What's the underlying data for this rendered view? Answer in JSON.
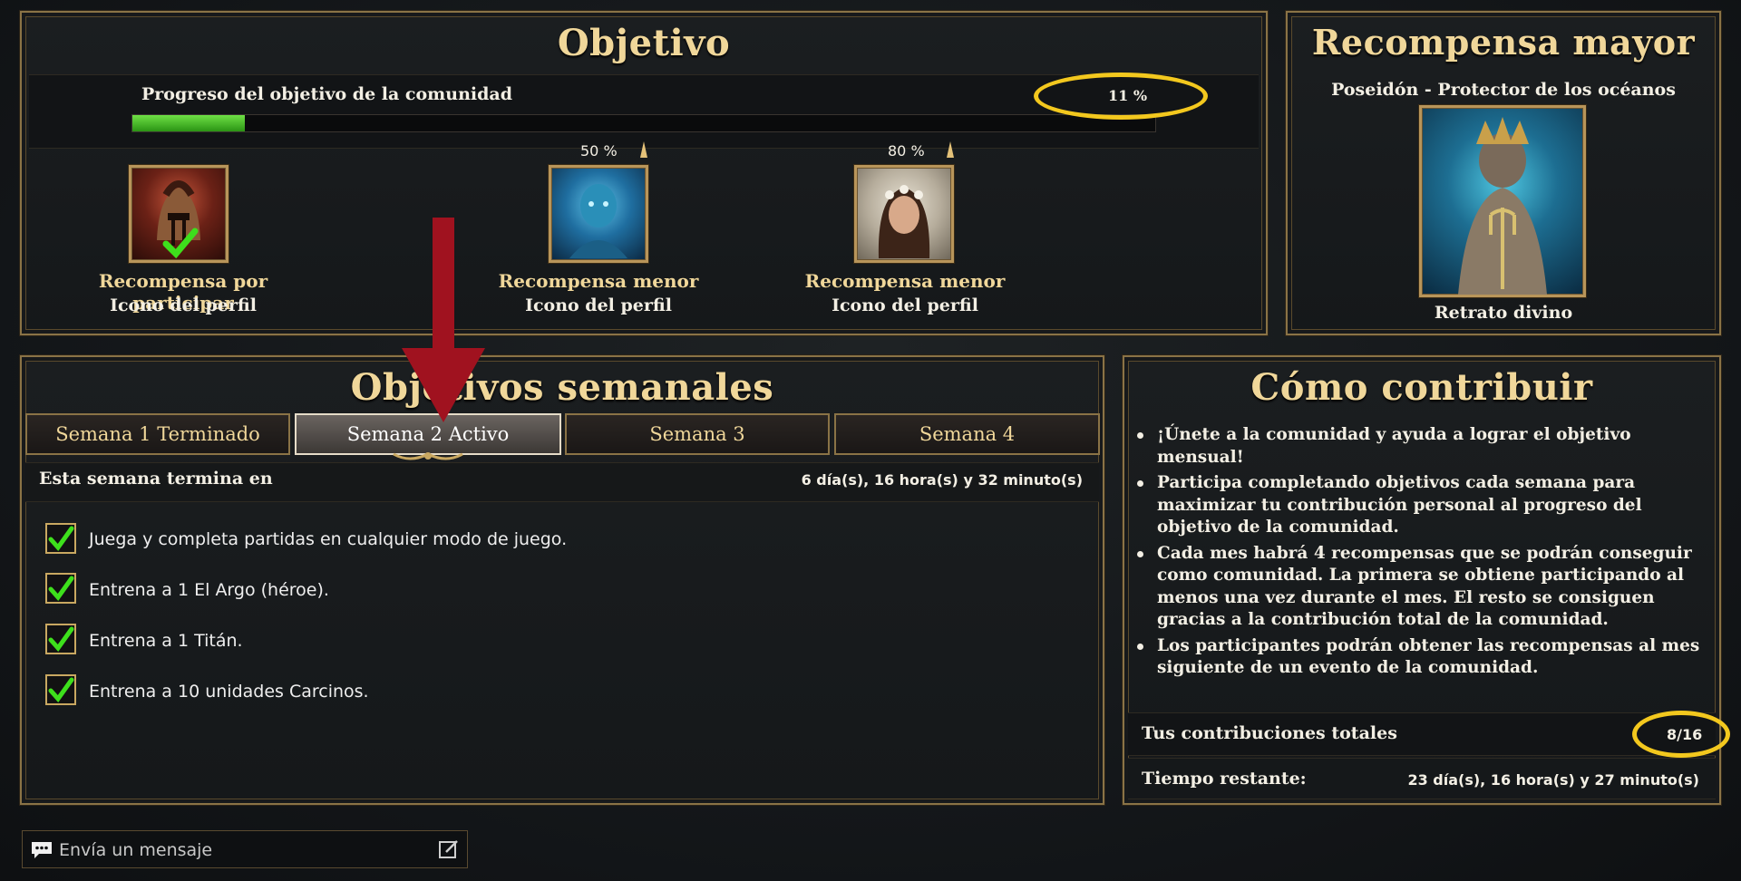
{
  "objective": {
    "title": "Objetivo",
    "progress_label": "Progreso del objetivo de la comunidad",
    "progress_value": "11 %",
    "progress_fraction": 0.11,
    "rewards": [
      {
        "threshold": "",
        "name": "Recompensa por participar",
        "type": "Icono del perfil",
        "icon": "spartan-helmet-portrait",
        "completed": true
      },
      {
        "threshold": "50 %",
        "name": "Recompensa menor",
        "type": "Icono del perfil",
        "icon": "sea-creature-portrait",
        "completed": false
      },
      {
        "threshold": "80 %",
        "name": "Recompensa menor",
        "type": "Icono del perfil",
        "icon": "flower-crown-woman-portrait",
        "completed": false
      }
    ]
  },
  "major_reward": {
    "title": "Recompensa mayor",
    "subtitle": "Poseidón - Protector de los océanos",
    "type": "Retrato divino",
    "icon": "poseidon-portrait"
  },
  "weekly": {
    "title": "Objetivos semanales",
    "tabs": [
      {
        "label": "Semana 1 Terminado",
        "active": false
      },
      {
        "label": "Semana 2 Activo",
        "active": true
      },
      {
        "label": "Semana 3",
        "active": false
      },
      {
        "label": "Semana 4",
        "active": false
      }
    ],
    "ends_label": "Esta semana termina en",
    "ends_value": "6 día(s), 16 hora(s) y 32 minuto(s)",
    "tasks": [
      {
        "text": "Juega y completa partidas en cualquier modo de juego.",
        "done": true
      },
      {
        "text": "Entrena a 1 El Argo (héroe).",
        "done": true
      },
      {
        "text": "Entrena a 1 Titán.",
        "done": true
      },
      {
        "text": "Entrena a 10 unidades Carcinos.",
        "done": true
      }
    ]
  },
  "contribute": {
    "title": "Cómo contribuir",
    "bullets": [
      "¡Únete a la comunidad y ayuda a lograr el objetivo mensual!",
      "Participa completando objetivos cada semana para maximizar tu contribución personal al progreso del objetivo de la comunidad.",
      "Cada mes habrá 4 recompensas que se podrán conseguir como comunidad. La primera se obtiene participando al menos una vez durante el mes. El resto se consiguen gracias a la contribución total de la comunidad.",
      "Los participantes podrán obtener las recompensas al mes siguiente de un evento de la comunidad."
    ],
    "total_label": "Tus contribuciones totales",
    "total_value": "8/16",
    "time_label": "Tiempo restante:",
    "time_value": "23 día(s), 16 hora(s) y 27 minuto(s)"
  },
  "chat": {
    "placeholder": "Envía un mensaje"
  },
  "colors": {
    "gold": "#f0d79a",
    "frame": "#8a7346",
    "progress": "#3fb51e",
    "highlight": "#f3c81e",
    "arrow": "#a0121f",
    "check": "#3ee01c"
  }
}
